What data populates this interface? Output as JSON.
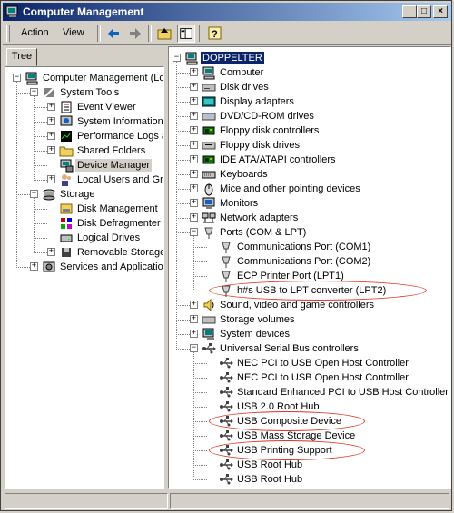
{
  "window": {
    "title": "Computer Management"
  },
  "menu": {
    "action": "Action",
    "view": "View"
  },
  "tab": {
    "tree": "Tree"
  },
  "left_tree": [
    {
      "label": "Computer Management (Local)",
      "icon": "computer-icon",
      "level": 0,
      "expander": "minus"
    },
    {
      "label": "System Tools",
      "icon": "tools-icon",
      "level": 1,
      "expander": "minus"
    },
    {
      "label": "Event Viewer",
      "icon": "event-viewer-icon",
      "level": 2,
      "expander": "plus"
    },
    {
      "label": "System Information",
      "icon": "info-icon",
      "level": 2,
      "expander": "plus"
    },
    {
      "label": "Performance Logs and A",
      "icon": "performance-icon",
      "level": 2,
      "expander": "plus"
    },
    {
      "label": "Shared Folders",
      "icon": "folder-icon",
      "level": 2,
      "expander": "plus"
    },
    {
      "label": "Device Manager",
      "icon": "device-manager-icon",
      "level": 2,
      "expander": "none",
      "selected": true
    },
    {
      "label": "Local Users and Groups",
      "icon": "users-icon",
      "level": 2,
      "expander": "plus"
    },
    {
      "label": "Storage",
      "icon": "storage-icon",
      "level": 1,
      "expander": "minus"
    },
    {
      "label": "Disk Management",
      "icon": "disk-icon",
      "level": 2,
      "expander": "none"
    },
    {
      "label": "Disk Defragmenter",
      "icon": "defrag-icon",
      "level": 2,
      "expander": "none"
    },
    {
      "label": "Logical Drives",
      "icon": "drive-icon",
      "level": 2,
      "expander": "none"
    },
    {
      "label": "Removable Storage",
      "icon": "removable-icon",
      "level": 2,
      "expander": "plus"
    },
    {
      "label": "Services and Applications",
      "icon": "services-icon",
      "level": 1,
      "expander": "plus"
    }
  ],
  "right_tree": [
    {
      "label": "DOPPELTER",
      "icon": "computer-icon",
      "level": 0,
      "expander": "minus",
      "selected": true
    },
    {
      "label": "Computer",
      "icon": "computer-icon",
      "level": 1,
      "expander": "plus"
    },
    {
      "label": "Disk drives",
      "icon": "disk-drive-icon",
      "level": 1,
      "expander": "plus"
    },
    {
      "label": "Display adapters",
      "icon": "display-icon",
      "level": 1,
      "expander": "plus"
    },
    {
      "label": "DVD/CD-ROM drives",
      "icon": "cdrom-icon",
      "level": 1,
      "expander": "plus"
    },
    {
      "label": "Floppy disk controllers",
      "icon": "controller-icon",
      "level": 1,
      "expander": "plus"
    },
    {
      "label": "Floppy disk drives",
      "icon": "floppy-icon",
      "level": 1,
      "expander": "plus"
    },
    {
      "label": "IDE ATA/ATAPI controllers",
      "icon": "controller-icon",
      "level": 1,
      "expander": "plus"
    },
    {
      "label": "Keyboards",
      "icon": "keyboard-icon",
      "level": 1,
      "expander": "plus"
    },
    {
      "label": "Mice and other pointing devices",
      "icon": "mouse-icon",
      "level": 1,
      "expander": "plus"
    },
    {
      "label": "Monitors",
      "icon": "monitor-icon",
      "level": 1,
      "expander": "plus"
    },
    {
      "label": "Network adapters",
      "icon": "network-icon",
      "level": 1,
      "expander": "plus"
    },
    {
      "label": "Ports (COM & LPT)",
      "icon": "port-icon",
      "level": 1,
      "expander": "minus"
    },
    {
      "label": "Communications Port (COM1)",
      "icon": "port-icon",
      "level": 2,
      "expander": "none"
    },
    {
      "label": "Communications Port (COM2)",
      "icon": "port-icon",
      "level": 2,
      "expander": "none"
    },
    {
      "label": "ECP Printer Port (LPT1)",
      "icon": "port-icon",
      "level": 2,
      "expander": "none"
    },
    {
      "label": "h#s USB to LPT converter (LPT2)",
      "icon": "port-icon",
      "level": 2,
      "expander": "none",
      "highlighted": true
    },
    {
      "label": "Sound, video and game controllers",
      "icon": "sound-icon",
      "level": 1,
      "expander": "plus"
    },
    {
      "label": "Storage volumes",
      "icon": "storage-volume-icon",
      "level": 1,
      "expander": "plus"
    },
    {
      "label": "System devices",
      "icon": "system-device-icon",
      "level": 1,
      "expander": "plus"
    },
    {
      "label": "Universal Serial Bus controllers",
      "icon": "usb-icon",
      "level": 1,
      "expander": "minus"
    },
    {
      "label": "NEC PCI to USB Open Host Controller",
      "icon": "usb-icon",
      "level": 2,
      "expander": "none"
    },
    {
      "label": "NEC PCI to USB Open Host Controller",
      "icon": "usb-icon",
      "level": 2,
      "expander": "none"
    },
    {
      "label": "Standard Enhanced PCI to USB Host Controller",
      "icon": "usb-icon",
      "level": 2,
      "expander": "none"
    },
    {
      "label": "USB 2.0 Root Hub",
      "icon": "usb-icon",
      "level": 2,
      "expander": "none"
    },
    {
      "label": "USB Composite Device",
      "icon": "usb-icon",
      "level": 2,
      "expander": "none",
      "highlighted": true
    },
    {
      "label": "USB Mass Storage Device",
      "icon": "usb-icon",
      "level": 2,
      "expander": "none"
    },
    {
      "label": "USB Printing Support",
      "icon": "usb-icon",
      "level": 2,
      "expander": "none",
      "highlighted": true
    },
    {
      "label": "USB Root Hub",
      "icon": "usb-icon",
      "level": 2,
      "expander": "none"
    },
    {
      "label": "USB Root Hub",
      "icon": "usb-icon",
      "level": 2,
      "expander": "none"
    }
  ],
  "colors": {
    "title_start": "#0a246a",
    "title_end": "#a6caf0",
    "selection": "#0a246a",
    "annotation": "#e03020",
    "face": "#d4d0c8"
  }
}
